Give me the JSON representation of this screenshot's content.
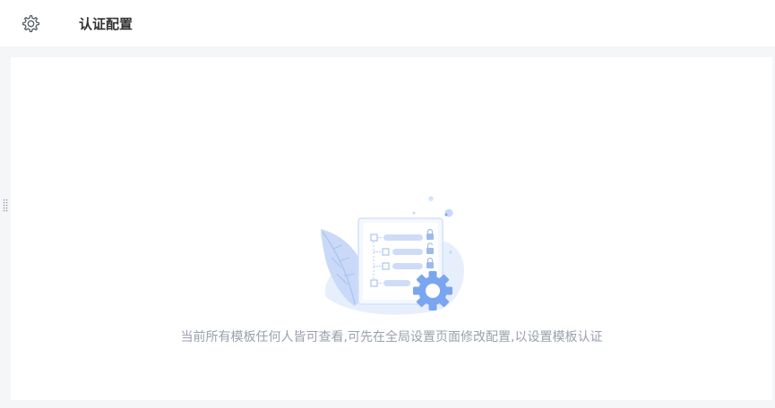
{
  "header": {
    "settings_icon": "gear-icon",
    "title": "认证配置"
  },
  "side_handle": {
    "icon": "drag-handle-icon"
  },
  "empty_state": {
    "illustration": "template-lock-settings-illustration",
    "message": "当前所有模板任何人皆可查看,可先在全局设置页面修改配置,以设置模板认证"
  },
  "colors": {
    "background": "#f5f6f8",
    "panel": "#ffffff",
    "title": "#333333",
    "muted_text": "#9aa0ad",
    "illustration_blue": "#7aa5f0",
    "illustration_light": "#e3ecfc"
  }
}
